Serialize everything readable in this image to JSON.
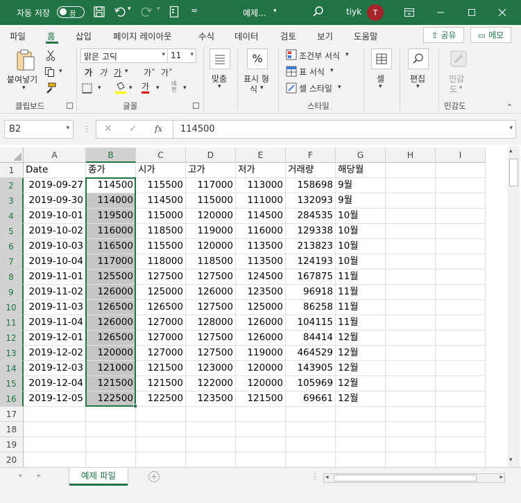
{
  "titlebar": {
    "autosave_label": "자동 저장",
    "autosave_state": "끔",
    "file_title": "예제...",
    "user_name": "tiyk",
    "avatar_initial": "T"
  },
  "menu": {
    "items": [
      "파일",
      "홈",
      "삽입",
      "페이지 레이아웃",
      "수식",
      "데이터",
      "검토",
      "보기",
      "도움말"
    ],
    "active": "홈",
    "share_label": "공유",
    "memo_label": "메모"
  },
  "ribbon": {
    "paste_label": "붙여넣기",
    "clipboard_group": "클립보드",
    "font_name": "맑은 고딕",
    "font_size": "11",
    "bold": "가",
    "italic": "가",
    "underline": "가",
    "grow_font": "가˄",
    "shrink_font": "가˅",
    "phonetic": "내천",
    "font_color_letter": "가",
    "font_group": "글꼴",
    "align_label": "맞춤",
    "number_label_1": "표시 형",
    "number_label_2": "식",
    "cond_format": "조건부 서식",
    "table_format": "표 서식",
    "cell_style": "셀 스타일",
    "style_group": "스타일",
    "cells_label": "셀",
    "edit_label": "편집",
    "sensitivity_label_1": "민감",
    "sensitivity_label_2": "도",
    "sensitivity_group": "민감도"
  },
  "formula_bar": {
    "name_box": "B2",
    "value": "114500"
  },
  "columns": [
    "A",
    "B",
    "C",
    "D",
    "E",
    "F",
    "G",
    "H",
    "I"
  ],
  "selected_column": "B",
  "row_numbers": [
    "1",
    "2",
    "3",
    "4",
    "5",
    "6",
    "7",
    "8",
    "9",
    "10",
    "11",
    "12",
    "13",
    "14",
    "15",
    "16",
    "17",
    "18",
    "19",
    "20"
  ],
  "table": {
    "headers": [
      "Date",
      "종가",
      "시가",
      "고가",
      "저가",
      "거래량",
      "해당월"
    ],
    "rows": [
      [
        "2019-09-27",
        "114500",
        "115500",
        "117000",
        "113000",
        "158698",
        "9월"
      ],
      [
        "2019-09-30",
        "114000",
        "114500",
        "115000",
        "111000",
        "132093",
        "9월"
      ],
      [
        "2019-10-01",
        "119500",
        "115000",
        "120000",
        "114500",
        "284535",
        "10월"
      ],
      [
        "2019-10-02",
        "116000",
        "118500",
        "119000",
        "116000",
        "129338",
        "10월"
      ],
      [
        "2019-10-03",
        "116500",
        "115500",
        "120000",
        "113500",
        "213823",
        "10월"
      ],
      [
        "2019-10-04",
        "117000",
        "118000",
        "118500",
        "113500",
        "124193",
        "10월"
      ],
      [
        "2019-11-01",
        "125500",
        "127500",
        "127500",
        "124500",
        "167875",
        "11월"
      ],
      [
        "2019-11-02",
        "126000",
        "125000",
        "126000",
        "123500",
        "96918",
        "11월"
      ],
      [
        "2019-11-03",
        "126500",
        "126500",
        "127500",
        "125000",
        "86258",
        "11월"
      ],
      [
        "2019-11-04",
        "126000",
        "127000",
        "128000",
        "126000",
        "104115",
        "11월"
      ],
      [
        "2019-12-01",
        "126500",
        "127000",
        "127500",
        "126000",
        "84414",
        "12월"
      ],
      [
        "2019-12-02",
        "120000",
        "127000",
        "127500",
        "119000",
        "464529",
        "12월"
      ],
      [
        "2019-12-03",
        "121000",
        "121500",
        "123000",
        "120000",
        "143905",
        "12월"
      ],
      [
        "2019-12-04",
        "121500",
        "121500",
        "122000",
        "120000",
        "105969",
        "12월"
      ],
      [
        "2019-12-05",
        "122500",
        "122500",
        "123500",
        "121500",
        "69661",
        "12월"
      ]
    ]
  },
  "sheet_tabs": [
    "예제 파일"
  ],
  "colors": {
    "brand": "#217346",
    "selection": "#c6c6c6"
  }
}
